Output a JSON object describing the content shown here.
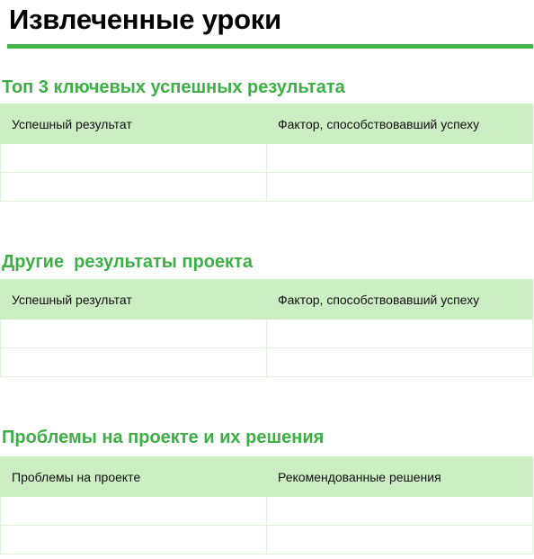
{
  "page": {
    "title": "Извлеченные уроки",
    "accent_color": "#44b649",
    "heading_color": "#3caf45",
    "table_header_bg": "#cdeec5"
  },
  "sections": [
    {
      "heading": "Топ 3 ключевых успешных результата",
      "columns": [
        "Успешный результат",
        "Фактор, способствовавший успеху"
      ],
      "rows": [
        [
          "",
          ""
        ],
        [
          "",
          ""
        ]
      ]
    },
    {
      "heading": "Другие  результаты проекта",
      "columns": [
        "Успешный результат",
        "Фактор, способствовавший успеху"
      ],
      "rows": [
        [
          "",
          ""
        ],
        [
          "",
          ""
        ]
      ]
    },
    {
      "heading": "Проблемы на проекте и их решения",
      "columns": [
        "Проблемы на проекте",
        "Рекомендованные решения"
      ],
      "rows": [
        [
          "",
          ""
        ],
        [
          "",
          ""
        ]
      ]
    }
  ]
}
